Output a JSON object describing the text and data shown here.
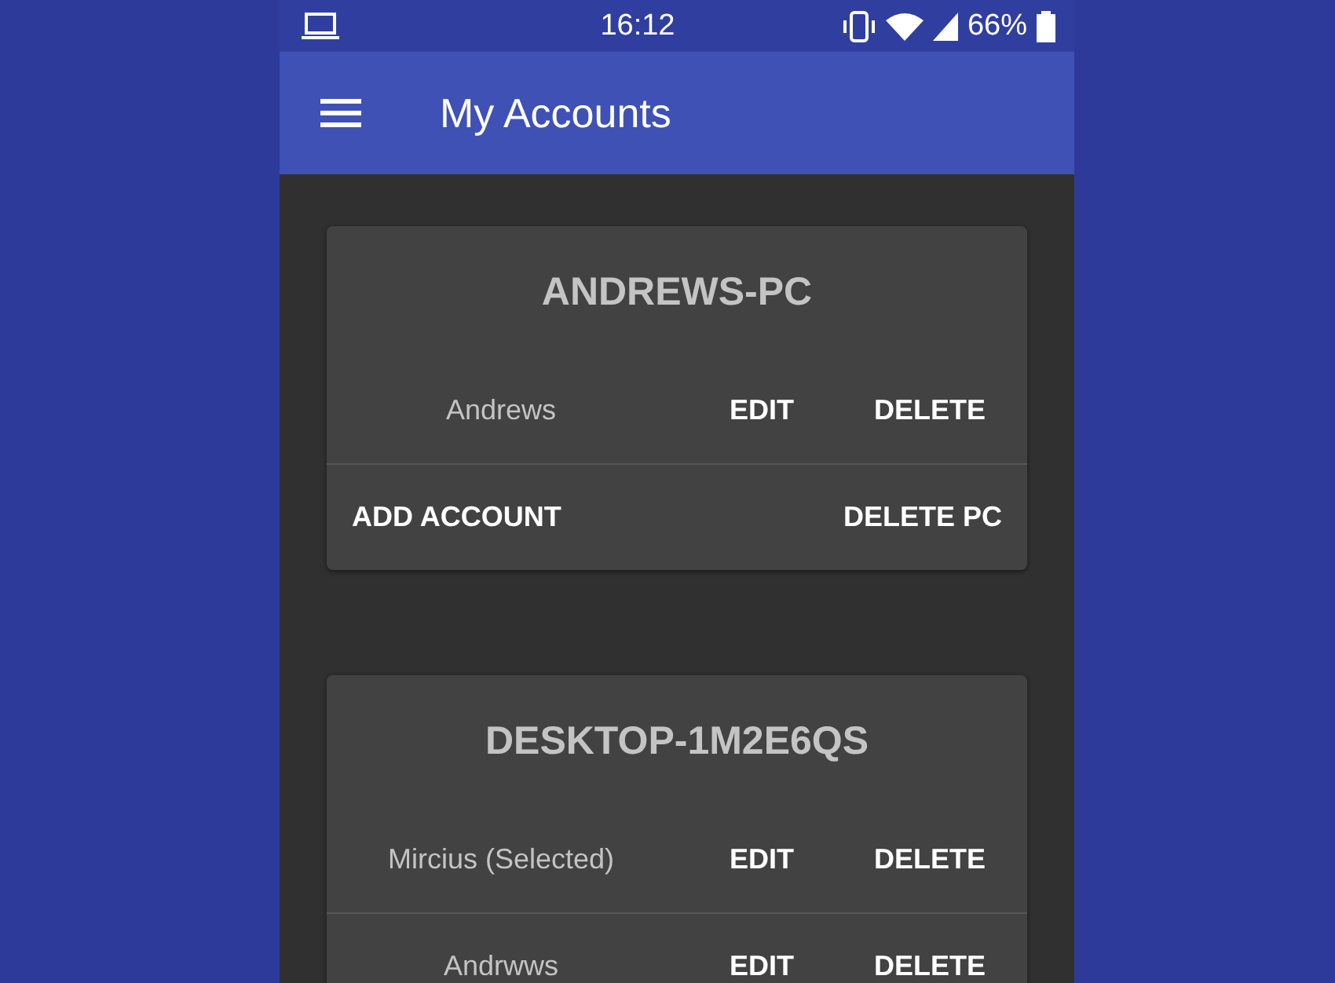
{
  "status_bar": {
    "time": "16:12",
    "battery": "66%"
  },
  "app_bar": {
    "title": "My Accounts"
  },
  "pcs": [
    {
      "name": "ANDREWS-PC",
      "accounts": [
        {
          "name": "Andrews",
          "edit": "EDIT",
          "delete": "DELETE"
        }
      ],
      "footer": {
        "add": "ADD ACCOUNT",
        "delete": "DELETE PC"
      }
    },
    {
      "name": "DESKTOP-1M2E6QS",
      "accounts": [
        {
          "name": "Mircius (Selected)",
          "edit": "EDIT",
          "delete": "DELETE"
        },
        {
          "name": "Andrwws",
          "edit": "EDIT",
          "delete": "DELETE"
        }
      ]
    }
  ]
}
